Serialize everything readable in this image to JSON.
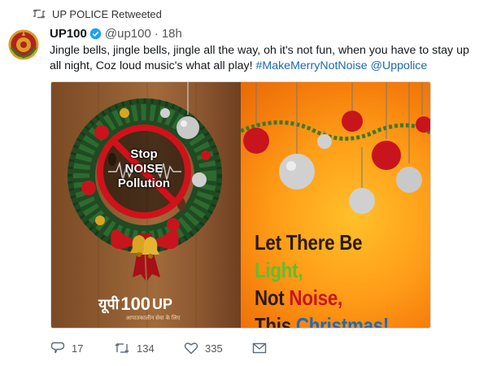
{
  "retweet_header": {
    "label": "UP POLICE Retweeted",
    "icon": "retweet-icon"
  },
  "author": {
    "name": "UP100",
    "handle": "@up100",
    "separator": "·",
    "time": "18h",
    "verified_icon": "verified-badge-icon"
  },
  "tweet": {
    "text": "Jingle bells, jingle bells, jingle all the way, oh it's not fun, when you have to stay up all night, Coz loud music's what all play!",
    "hashtag": "#MakeMerryNotNoise",
    "mention": "@Uppolice"
  },
  "media": {
    "stop_line1": "Stop",
    "stop_line2": "NOISE",
    "stop_line3": "Pollution",
    "logo_prefix": "यूपी",
    "logo_number": "100",
    "logo_suffix": "UP",
    "logo_tagline": "आपातकालीन सेवा के लिए",
    "slogan_line1_a": "Let There Be ",
    "slogan_line1_b": "Light,",
    "slogan_line2_a": "Not ",
    "slogan_line2_b": "Noise,",
    "slogan_line3_a": "This ",
    "slogan_line3_b": "Christmas!"
  },
  "actions": {
    "reply_count": "17",
    "retweet_count": "134",
    "like_count": "335"
  },
  "colors": {
    "link": "#1b6aa8",
    "verified": "#1da1f2",
    "light_word": "#5fbf2b",
    "noise_word": "#c8161d",
    "christmas_word": "#1e6bb8"
  }
}
